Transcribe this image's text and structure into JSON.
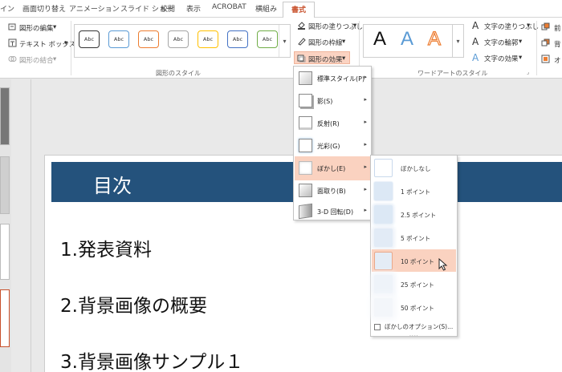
{
  "tabs": [
    {
      "label": "イン"
    },
    {
      "label": "画面切り替え"
    },
    {
      "label": "アニメーション"
    },
    {
      "label": "スライド ショー"
    },
    {
      "label": "校閲"
    },
    {
      "label": "表示"
    },
    {
      "label": "ACROBAT"
    },
    {
      "label": "横組み"
    },
    {
      "label": "書式"
    }
  ],
  "insert_group": {
    "edit_shape": "図形の編集",
    "text_box": "テキスト ボックス",
    "merge_shapes": "図形の結合"
  },
  "shape_styles": {
    "label": "図形のスタイル",
    "gallery": [
      "Abc",
      "Abc",
      "Abc",
      "Abc",
      "Abc",
      "Abc",
      "Abc"
    ],
    "fill": "図形の塗りつぶし",
    "outline": "図形の枠線",
    "effects": "図形の効果",
    "colors": [
      "#333333",
      "#5b9bd5",
      "#ed7d31",
      "#a5a5a5",
      "#ffc000",
      "#4472c4",
      "#70ad47"
    ]
  },
  "wordart": {
    "label": "ワードアートのスタイル",
    "letters": [
      "A",
      "A",
      "A"
    ],
    "text_fill": "文字の塗りつぶし",
    "text_outline": "文字の輪郭",
    "text_effects": "文字の効果"
  },
  "arrange": {
    "items": [
      "前",
      "背",
      "オ"
    ]
  },
  "effects_menu": [
    {
      "label": "標準スタイル(P)"
    },
    {
      "label": "影(S)"
    },
    {
      "label": "反射(R)"
    },
    {
      "label": "光彩(G)"
    },
    {
      "label": "ぼかし(E)"
    },
    {
      "label": "面取り(B)"
    },
    {
      "label": "3-D 回転(D)"
    }
  ],
  "blur_submenu": {
    "items": [
      {
        "label": "ぼかしなし"
      },
      {
        "label": "1 ポイント"
      },
      {
        "label": "2.5 ポイント"
      },
      {
        "label": "5 ポイント"
      },
      {
        "label": "10 ポイント"
      },
      {
        "label": "25 ポイント"
      },
      {
        "label": "50 ポイント"
      }
    ],
    "options": "ぼかしのオプション(S)..."
  },
  "slide": {
    "title": "目次",
    "bullets": [
      "1.発表資料",
      "2.背景画像の概要",
      "3.背景画像サンプル１"
    ]
  },
  "colors": {
    "accent": "#c8502b",
    "highlight": "#fad2c0",
    "title_bar": "#24527c"
  }
}
